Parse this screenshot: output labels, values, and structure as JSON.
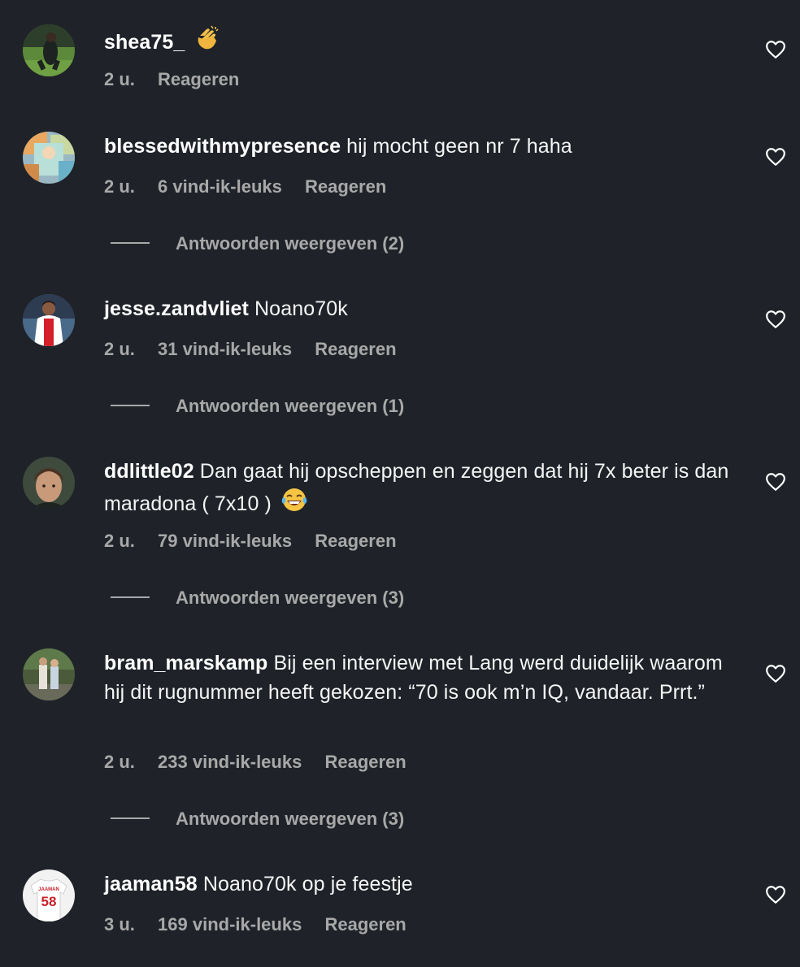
{
  "comments": [
    {
      "username": "shea75_",
      "text": "",
      "emoji": "clapping-hands",
      "time": "2 u.",
      "likes": "",
      "reply_label": "Reageren",
      "replies_label": ""
    },
    {
      "username": "blessedwithmypresence",
      "text": "hij mocht geen nr 7 haha",
      "time": "2 u.",
      "likes": "6 vind-ik-leuks",
      "reply_label": "Reageren",
      "replies_label": "Antwoorden weergeven (2)"
    },
    {
      "username": "jesse.zandvliet",
      "text": "Noano70k",
      "time": "2 u.",
      "likes": "31 vind-ik-leuks",
      "reply_label": "Reageren",
      "replies_label": "Antwoorden weergeven (1)"
    },
    {
      "username": "ddlittle02",
      "text": "Dan gaat hij opscheppen en zeggen dat hij 7x beter is dan maradona ( 7x10 )",
      "emoji": "face-with-tears-of-joy",
      "time": "2 u.",
      "likes": "79 vind-ik-leuks",
      "reply_label": "Reageren",
      "replies_label": "Antwoorden weergeven (3)"
    },
    {
      "username": "bram_marskamp",
      "text": "Bij een interview met Lang werd duidelijk waarom hij dit rugnummer heeft gekozen: “70 is ook m’n IQ, vandaar. Prrt.”",
      "time": "2 u.",
      "likes": "233 vind-ik-leuks",
      "reply_label": "Reageren",
      "replies_label": "Antwoorden weergeven (3)"
    },
    {
      "username": "jaaman58",
      "text": "Noano70k op je feestje",
      "time": "3 u.",
      "likes": "169 vind-ik-leuks",
      "reply_label": "Reageren",
      "replies_label": ""
    }
  ],
  "avatar_jersey": {
    "name": "JAAMAN",
    "number": "58"
  },
  "colors": {
    "background": "#1f2329",
    "secondary_text": "#a8a8a8",
    "primary_text": "#ffffff"
  }
}
